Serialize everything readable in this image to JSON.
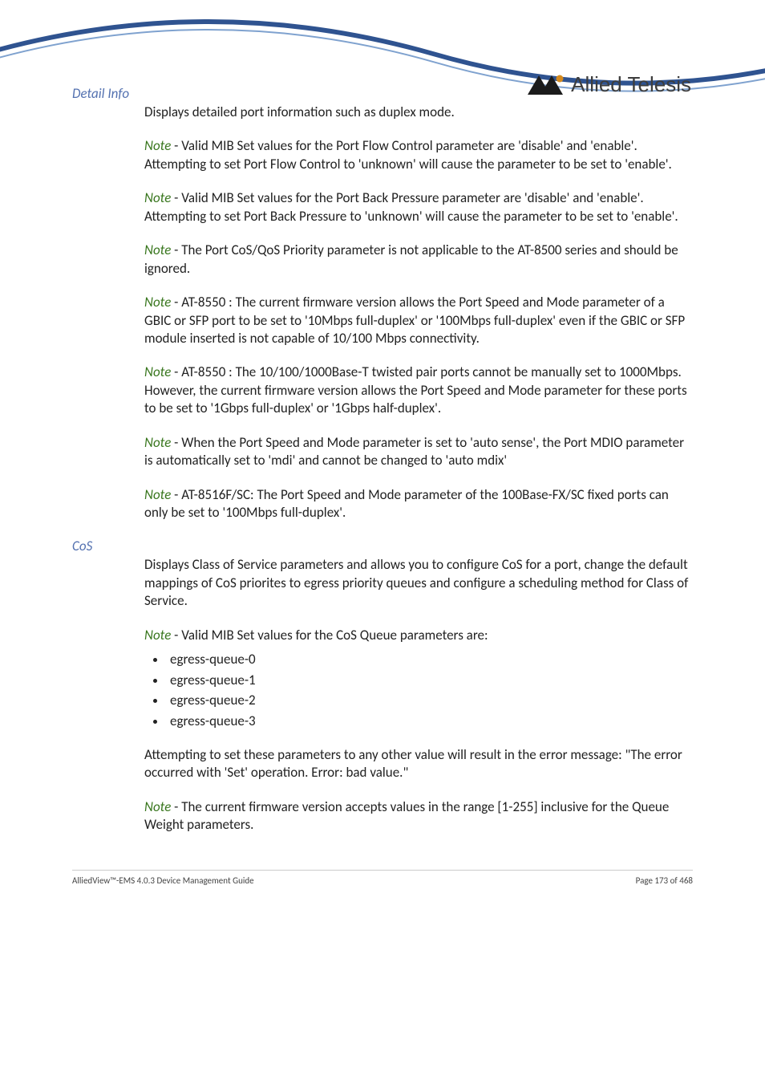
{
  "header": {
    "logo_text": "Allied Telesis"
  },
  "section_detail": {
    "label": "Detail Info",
    "intro": "Displays detailed port information such as duplex mode.",
    "notes": [
      {
        "prefix": "Note",
        "text": " - Valid MIB Set values for the Port Flow Control parameter are 'disable' and 'enable'. Attempting to set Port Flow Control to 'unknown' will cause the parameter to be set to 'enable'."
      },
      {
        "prefix": "Note",
        "text": " - Valid MIB Set values for the Port Back Pressure parameter are 'disable' and 'enable'. Attempting to set Port Back Pressure to 'unknown' will cause the parameter to be set to 'enable'."
      },
      {
        "prefix": "Note",
        "text": " - The Port CoS/QoS Priority parameter is not applicable to the AT-8500 series and should be ignored."
      },
      {
        "prefix": "Note",
        "text": " - AT-8550 : The current firmware version allows the Port Speed and Mode parameter of a GBIC or SFP port to be set to '10Mbps full-duplex' or '100Mbps full-duplex' even if the GBIC or SFP module inserted is not capable of 10/100 Mbps connectivity."
      },
      {
        "prefix": "Note",
        "text": " - AT-8550 : The 10/100/1000Base-T twisted pair ports cannot be manually set to 1000Mbps. However, the current firmware version allows the Port Speed and Mode parameter for these ports to be set to '1Gbps full-duplex' or '1Gbps half-duplex'."
      },
      {
        "prefix": "Note",
        "text": " - When the Port Speed and Mode parameter is set to 'auto sense', the Port MDIO parameter is automatically set to 'mdi' and cannot be changed to 'auto mdix'"
      },
      {
        "prefix": "Note",
        "text": " - AT-8516F/SC: The Port Speed and Mode parameter of the 100Base-FX/SC fixed ports can only be set to '100Mbps full-duplex'."
      }
    ]
  },
  "section_cos": {
    "label": "CoS",
    "intro": "Displays Class of Service parameters and allows you to configure CoS for a port, change the default mappings of CoS priorites to egress priority queues and configure a scheduling method for Class of Service.",
    "note_valid": {
      "prefix": "Note",
      "text": " - Valid MIB Set values for the CoS Queue parameters are:"
    },
    "queues": [
      "egress-queue-0",
      "egress-queue-1",
      "egress-queue-2",
      "egress-queue-3"
    ],
    "attempt_text": "Attempting to set these parameters to any other value will result in the error message: \"The error occurred with 'Set' operation. Error: bad value.\"",
    "note_range": {
      "prefix": "Note",
      "text": " - The current firmware version accepts values in the range [1-255] inclusive for the Queue Weight parameters."
    }
  },
  "footer": {
    "left": "AlliedView™-EMS 4.0.3 Device Management Guide",
    "right": "Page 173 of 468"
  }
}
